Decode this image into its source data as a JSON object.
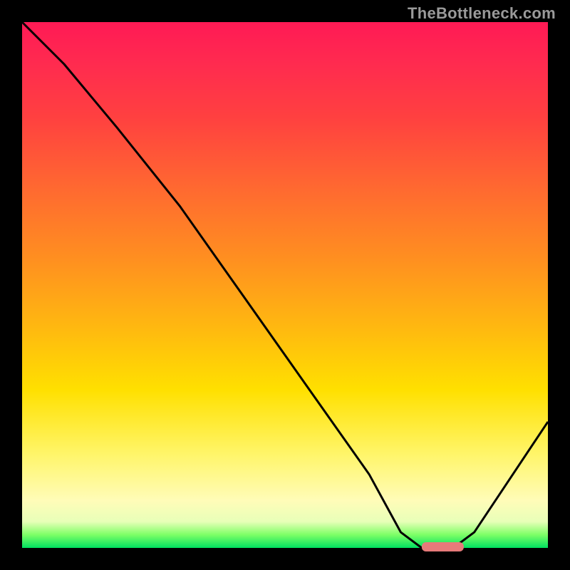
{
  "watermark": {
    "text": "TheBottleneck.com"
  },
  "marker": {
    "color": "#e77a7a",
    "rx": 6
  },
  "chart_data": {
    "type": "line",
    "title": "",
    "xlabel": "",
    "ylabel": "",
    "xlim": [
      0,
      100
    ],
    "ylim": [
      0,
      100
    ],
    "grid": false,
    "legend": false,
    "series": [
      {
        "name": "curve",
        "x": [
          0,
          8,
          18,
          30,
          42,
          54,
          66,
          72,
          76,
          82,
          86,
          92,
          100
        ],
        "y": [
          100,
          92,
          80,
          65,
          48,
          31,
          14,
          3,
          0,
          0,
          3,
          12,
          24
        ]
      }
    ],
    "marker_segment": {
      "x_start": 76,
      "x_end": 84,
      "y": 0
    }
  }
}
